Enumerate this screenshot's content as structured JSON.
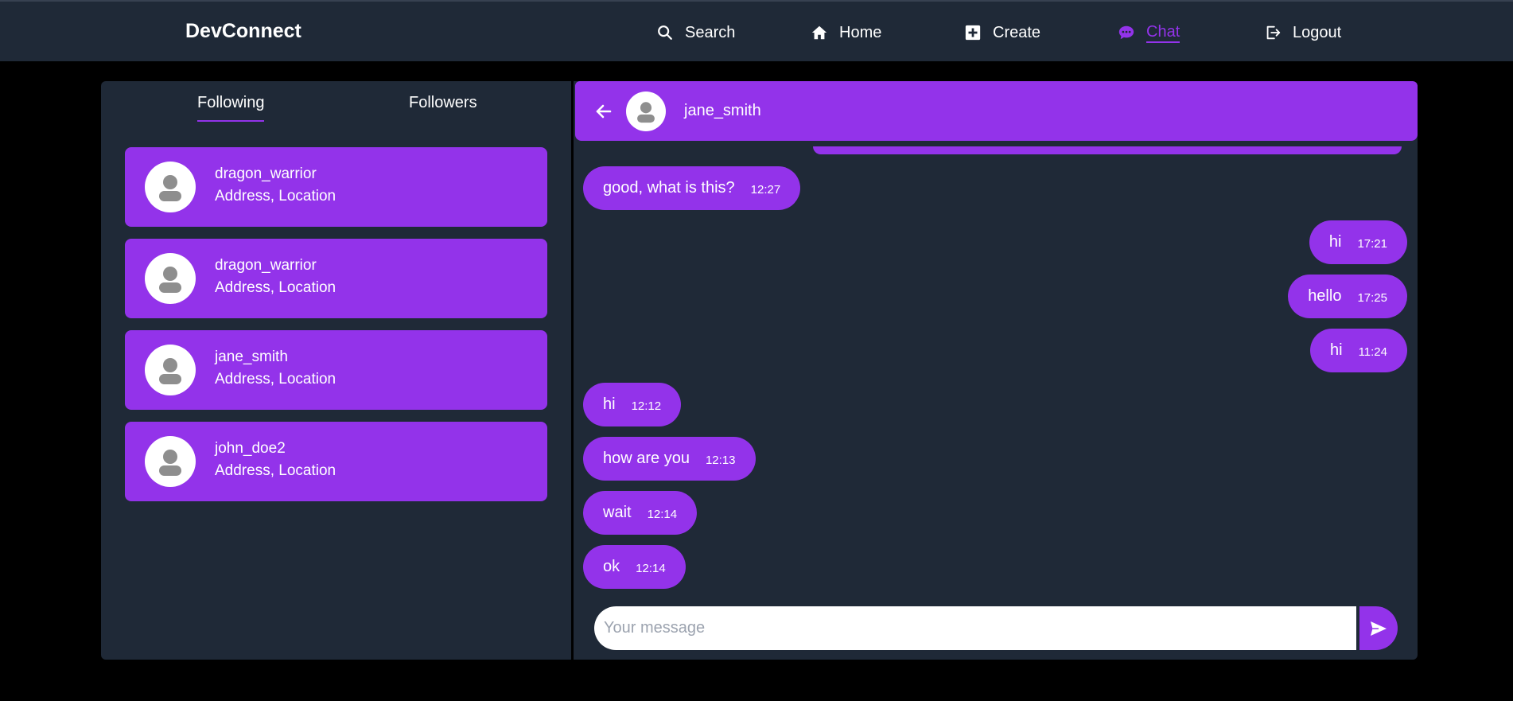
{
  "navbar": {
    "brand": "DevConnect",
    "items": [
      {
        "label": "Search",
        "icon": "search-icon"
      },
      {
        "label": "Home",
        "icon": "home-icon"
      },
      {
        "label": "Create",
        "icon": "plus-square-icon"
      },
      {
        "label": "Chat",
        "icon": "chat-bubble-icon",
        "active": true
      },
      {
        "label": "Logout",
        "icon": "logout-icon"
      }
    ]
  },
  "sidebar": {
    "tabs": [
      {
        "label": "Following",
        "active": true
      },
      {
        "label": "Followers",
        "active": false
      }
    ],
    "users": [
      {
        "name": "dragon_warrior",
        "address": "Address, Location"
      },
      {
        "name": "dragon_warrior",
        "address": "Address, Location"
      },
      {
        "name": "jane_smith",
        "address": "Address, Location"
      },
      {
        "name": "john_doe2",
        "address": "Address, Location"
      }
    ]
  },
  "chat": {
    "contact_name": "jane_smith",
    "messages": [
      {
        "text": "good, what is this?",
        "time": "12:27",
        "side": "left"
      },
      {
        "text": "hi",
        "time": "17:21",
        "side": "right"
      },
      {
        "text": "hello",
        "time": "17:25",
        "side": "right"
      },
      {
        "text": "hi",
        "time": "11:24",
        "side": "right"
      },
      {
        "text": "hi",
        "time": "12:12",
        "side": "left"
      },
      {
        "text": "how are you",
        "time": "12:13",
        "side": "left"
      },
      {
        "text": "wait",
        "time": "12:14",
        "side": "left"
      },
      {
        "text": "ok",
        "time": "12:14",
        "side": "left"
      }
    ],
    "input_placeholder": "Your message",
    "input_value": ""
  },
  "colors": {
    "accent": "#9333ea",
    "panel": "#1f2937",
    "background": "#000000"
  }
}
